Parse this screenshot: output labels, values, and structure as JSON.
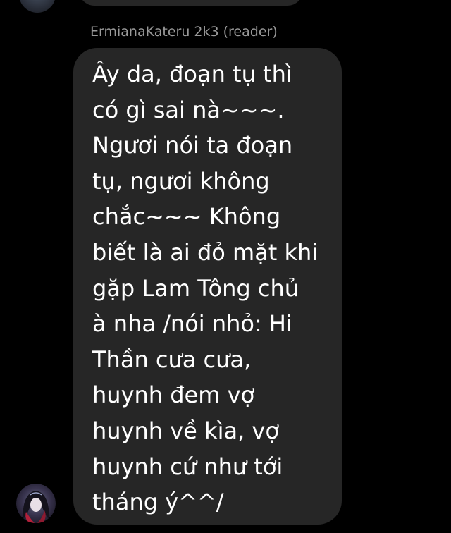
{
  "chat": {
    "sender_name": "ErmianaKateru 2k3 (reader)",
    "message_lines": [
      "Ây da, đoạn tụ thì",
      "có gì sai nà~~~.",
      "Ngươi nói ta đoạn",
      "tụ, ngươi không",
      "chắc~~~ Không",
      "biết là ai đỏ mặt khi",
      "gặp Lam Tông chủ",
      "à nha /nói nhỏ: Hi",
      "Thần cưa cưa,",
      "huynh đem vợ",
      "huynh về kìa, vợ",
      "huynh cứ như tới",
      "tháng ý^^/"
    ],
    "avatar_icon": "user-avatar-icon",
    "colors": {
      "background": "#000000",
      "bubble": "#262626",
      "message_text": "#ffffff",
      "sender_name": "#9a9a9a"
    }
  }
}
